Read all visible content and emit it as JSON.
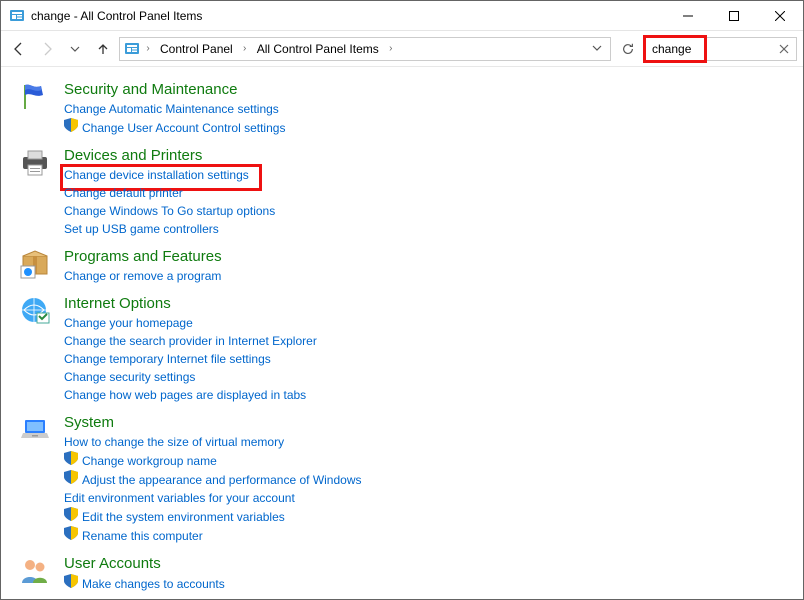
{
  "window": {
    "title": "change - All Control Panel Items"
  },
  "breadcrumb": {
    "root": "Control Panel",
    "items": "All Control Panel Items"
  },
  "search": {
    "value": "change"
  },
  "categories": [
    {
      "icon": "flag",
      "title": "Security and Maintenance",
      "links": [
        {
          "text": "Change Automatic Maintenance settings",
          "shield": false
        },
        {
          "text": "Change User Account Control settings",
          "shield": true
        }
      ]
    },
    {
      "icon": "printer",
      "title": "Devices and Printers",
      "links": [
        {
          "text": "Change device installation settings",
          "shield": false,
          "highlight": true
        },
        {
          "text": "Change default printer",
          "shield": false
        },
        {
          "text": "Change Windows To Go startup options",
          "shield": false
        },
        {
          "text": "Set up USB game controllers",
          "shield": false
        }
      ]
    },
    {
      "icon": "box",
      "title": "Programs and Features",
      "links": [
        {
          "text": "Change or remove a program",
          "shield": false
        }
      ]
    },
    {
      "icon": "globe",
      "title": "Internet Options",
      "links": [
        {
          "text": "Change your homepage",
          "shield": false
        },
        {
          "text": "Change the search provider in Internet Explorer",
          "shield": false
        },
        {
          "text": "Change temporary Internet file settings",
          "shield": false
        },
        {
          "text": "Change security settings",
          "shield": false
        },
        {
          "text": "Change how web pages are displayed in tabs",
          "shield": false
        }
      ]
    },
    {
      "icon": "laptop",
      "title": "System",
      "links": [
        {
          "text": "How to change the size of virtual memory",
          "shield": false
        },
        {
          "text": "Change workgroup name",
          "shield": true
        },
        {
          "text": "Adjust the appearance and performance of Windows",
          "shield": true
        },
        {
          "text": "Edit environment variables for your account",
          "shield": false
        },
        {
          "text": "Edit the system environment variables",
          "shield": true
        },
        {
          "text": "Rename this computer",
          "shield": true
        }
      ]
    },
    {
      "icon": "users",
      "title": "User Accounts",
      "links": [
        {
          "text": "Make changes to accounts",
          "shield": true
        }
      ]
    }
  ]
}
